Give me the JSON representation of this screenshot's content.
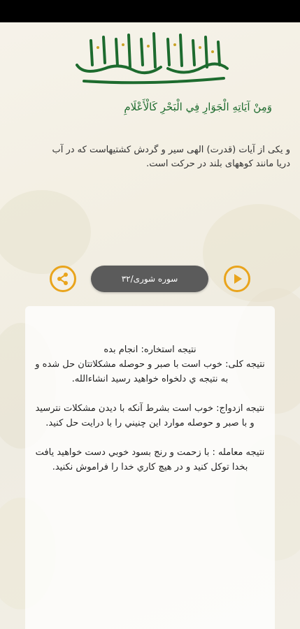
{
  "header": {
    "ayah": "وَمِنْ آيَاتِهِ الْجَوَارِ فِي الْبَحْرِ كَالْأَعْلَامِ",
    "translation": "و یکی از آیات (قدرت) الهی سیر و گردش کشتیهاست که در آب دریا مانند کوههای بلند در حرکت است."
  },
  "controls": {
    "surah_label": "سوره شوری/۳۲",
    "share_icon": "share-icon",
    "play_icon": "play-icon"
  },
  "result": {
    "line1": "نتیجه استخاره: انجام بده",
    "line2": "نتیجه کلی: خوب است با صبر و حوصله مشکلاتتان حل شده و به نتیجه ي دلخواه خواهید رسید انشاءالله.",
    "line3": "نتیجه ازدواج: خوب است بشرط آنکه با دیدن مشکلات نترسید و با صبر و حوصله موارد این چنیني را با درایت حل کنید.",
    "line4": "نتیجه معامله : با زحمت و رنج بسود خوبي دست خواهید یافت بخدا توکل کنید و در هیچ کاري خدا را فراموش نکنید."
  },
  "colors": {
    "accent": "#e9a41c",
    "calligraphy": "#1d6b2e",
    "pill": "#5b5b5b"
  }
}
